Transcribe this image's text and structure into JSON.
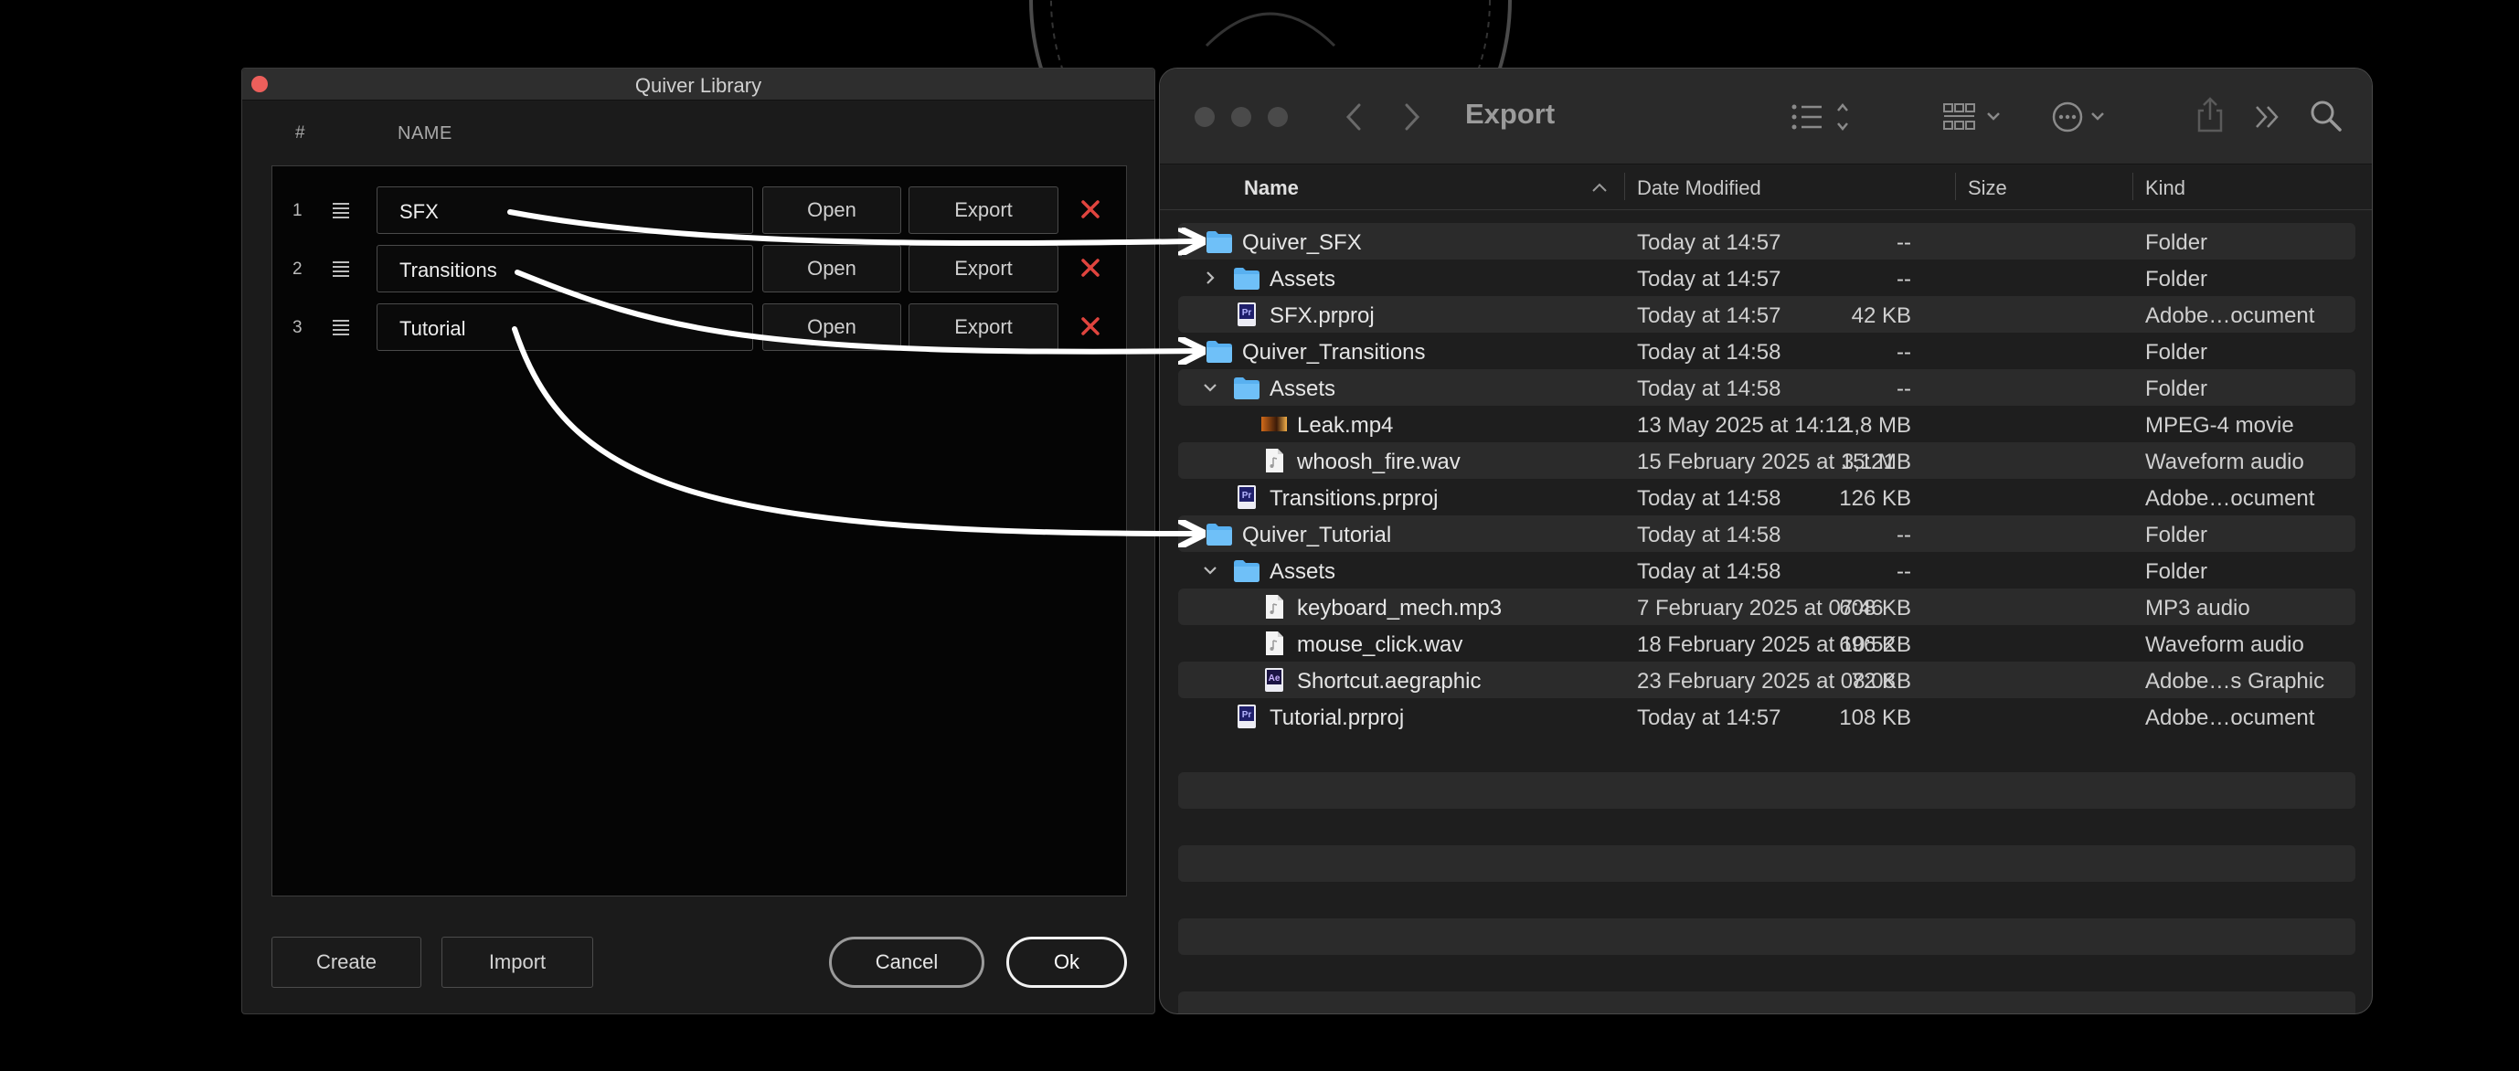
{
  "quiver": {
    "title": "Quiver Library",
    "col_hash": "#",
    "col_name": "NAME",
    "rows": [
      {
        "num": "1",
        "name": "SFX",
        "open": "Open",
        "export": "Export"
      },
      {
        "num": "2",
        "name": "Transitions",
        "open": "Open",
        "export": "Export"
      },
      {
        "num": "3",
        "name": "Tutorial",
        "open": "Open",
        "export": "Export"
      }
    ],
    "create": "Create",
    "import": "Import",
    "cancel": "Cancel",
    "ok": "Ok"
  },
  "finder": {
    "title": "Export",
    "columns": {
      "name": "Name",
      "date": "Date Modified",
      "size": "Size",
      "kind": "Kind"
    },
    "rows": [
      {
        "name": "Quiver_SFX",
        "date": "Today at 14:57",
        "size": "--",
        "kind": "Folder",
        "icon": "folder-icon"
      },
      {
        "name": "Assets",
        "date": "Today at 14:57",
        "size": "--",
        "kind": "Folder",
        "icon": "folder-icon",
        "disclosure": "collapsed"
      },
      {
        "name": "SFX.prproj",
        "date": "Today at 14:57",
        "size": "42 KB",
        "kind": "Adobe…ocument",
        "icon": "premiere-project-icon"
      },
      {
        "name": "Quiver_Transitions",
        "date": "Today at 14:58",
        "size": "--",
        "kind": "Folder",
        "icon": "folder-icon"
      },
      {
        "name": "Assets",
        "date": "Today at 14:58",
        "size": "--",
        "kind": "Folder",
        "icon": "folder-icon",
        "disclosure": "expanded"
      },
      {
        "name": "Leak.mp4",
        "date": "13 May 2025 at 14:12",
        "size": "1,8 MB",
        "kind": "MPEG-4 movie",
        "icon": "video-thumbnail-icon"
      },
      {
        "name": "whoosh_fire.wav",
        "date": "15 February 2025 at 15:21",
        "size": "3,1 MB",
        "kind": "Waveform audio",
        "icon": "audio-file-icon"
      },
      {
        "name": "Transitions.prproj",
        "date": "Today at 14:58",
        "size": "126 KB",
        "kind": "Adobe…ocument",
        "icon": "premiere-project-icon"
      },
      {
        "name": "Quiver_Tutorial",
        "date": "Today at 14:58",
        "size": "--",
        "kind": "Folder",
        "icon": "folder-icon"
      },
      {
        "name": "Assets",
        "date": "Today at 14:58",
        "size": "--",
        "kind": "Folder",
        "icon": "folder-icon",
        "disclosure": "expanded"
      },
      {
        "name": "keyboard_mech.mp3",
        "date": "7 February 2025 at 07:46",
        "size": "608 KB",
        "kind": "MP3 audio",
        "icon": "audio-file-icon"
      },
      {
        "name": "mouse_click.wav",
        "date": "18 February 2025 at 10:52",
        "size": "696 KB",
        "kind": "Waveform audio",
        "icon": "audio-file-icon"
      },
      {
        "name": "Shortcut.aegraphic",
        "date": "23 February 2025 at 08:08",
        "size": "72 KB",
        "kind": "Adobe…s Graphic",
        "icon": "after-effects-graphic-icon"
      },
      {
        "name": "Tutorial.prproj",
        "date": "Today at 14:57",
        "size": "108 KB",
        "kind": "Adobe…ocument",
        "icon": "premiere-project-icon"
      }
    ],
    "icon_labels": {
      "pr": "Pr",
      "ae": "Ae"
    }
  },
  "colors": {
    "dialog_bg": "#1b1b1b",
    "finder_bg": "#1e1e1e",
    "folder_blue": "#58b0f0",
    "delete_red": "#e0443e",
    "premiere_purple": "#1f1f6b"
  }
}
